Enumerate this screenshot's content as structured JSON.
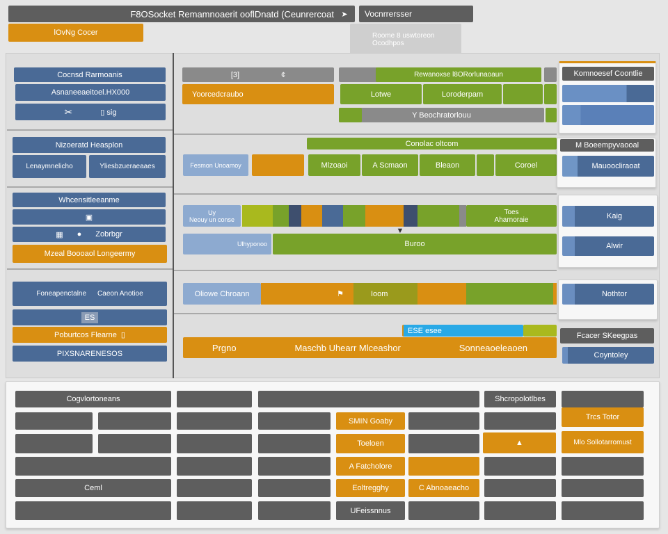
{
  "header": {
    "title": "F8OSocket Remamnoaerit ooflDnatd (Ceunrercoat",
    "title_icon": "arrow-icon",
    "tab": "Vocnrrersser",
    "orange_tab": "lOvNg Cocer",
    "tooltip_line1": "Roome 8 uswtoreon",
    "tooltip_line2": "Ocodhpos"
  },
  "sidebar": {
    "items": [
      "Cocnsd Rarmoanis",
      "Asnaneeaeitoel.HX000",
      "sig",
      "Nizoeratd Heasplon",
      "Lenaymnelicho",
      "Yliesbzueraeaaes",
      "Whcensitleeanme",
      "Zobrbgr",
      "Mzeal Boooaol Longeermy",
      "Foneapenctalne",
      "Caeon Anotioe",
      "ES",
      "Poburtcos Flearne",
      "PIXSNARENESOS"
    ]
  },
  "main": {
    "row1": {
      "gray_label": "[3]",
      "gray_label2": "¢",
      "orange": "Yoorcedcraubo",
      "green_header": "Rewanoxse l8ORorlunaoaun",
      "cells": [
        "Lotwe",
        "Loroderpam"
      ],
      "gray_bar": "Y Beochratorlouu"
    },
    "row2": {
      "header": "Conolac oltcom",
      "light": "Fesmon Unoamoy",
      "cells": [
        "Mlzoaoi",
        "A Scmaon",
        "Bleaon",
        "Coroel"
      ]
    },
    "row3": {
      "light1a": "Uy",
      "light1b": "Neouy un conse",
      "strip_label1": "Toes",
      "strip_label2": "Aharnoraie",
      "light2": "Ulhyponoo",
      "green": "Buroo"
    },
    "row4": {
      "light": "Oliowe Chroann",
      "olive": "Ioom"
    },
    "row5": {
      "blue_label": "ESE esee",
      "orange": [
        "Prgno",
        "Maschb Uhearr Mlceashor",
        "Sonneaoeleaoen"
      ]
    }
  },
  "right": {
    "card1_header": "Komnoesef Coontlie",
    "card2_header": "M Boeempyvaooal",
    "card2_item": "Mauoocliraoat",
    "card3_items": [
      "Kaig",
      "Alwir"
    ],
    "card4_item": "Nothtor",
    "header5": "Fcacer SKeegpas",
    "item5": "Coyntoley"
  },
  "grid": {
    "r1a": "Cogvlortoneans",
    "r1f": "Shcropolotlbes",
    "r2d": "SMIN Goaby",
    "r2g": "Trcs Totor",
    "r3d": "Toeloen",
    "r3f": "▲",
    "r3g": "Mlo Sollotarromust",
    "r4d": "A Fatcholore",
    "r5a": "Ceml",
    "r5d": "Eoltregghy",
    "r5e": "C Abnoaeacho",
    "r6d": "UFeissnnus"
  },
  "colors": {
    "blue": "#4a6a96",
    "orange": "#d98f12",
    "green": "#78a22a",
    "gray": "#5e5e5e",
    "light_blue": "#8daad0"
  }
}
